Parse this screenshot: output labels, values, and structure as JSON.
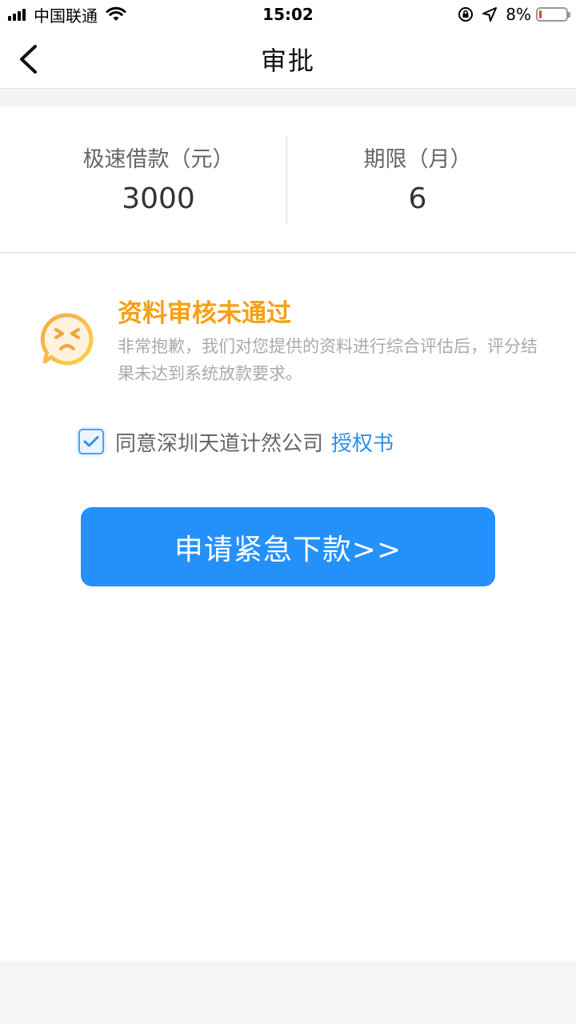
{
  "status_bar": {
    "carrier": "中国联通",
    "time": "15:02",
    "battery_percent": "8%",
    "battery_level": 0.08,
    "battery_color": "#e53935",
    "icons": [
      "signal-icon",
      "wifi-icon",
      "orientation-lock-icon",
      "location-icon",
      "battery-icon"
    ]
  },
  "nav": {
    "title": "审批",
    "back_icon": "chevron-left-icon"
  },
  "summary": {
    "loan_label": "极速借款（元）",
    "loan_value": "3000",
    "term_label": "期限（月）",
    "term_value": "6"
  },
  "result": {
    "icon": "sad-face-chat-icon",
    "title": "资料审核未通过",
    "description": "非常抱歉，我们对您提供的资料进行综合评估后，评分结果未达到系统放款要求。"
  },
  "agreement": {
    "checked": true,
    "text": "同意深圳天道计然公司",
    "link": "授权书"
  },
  "actions": {
    "apply_label": "申请紧急下款>>"
  },
  "colors": {
    "primary": "#2490fa",
    "warning": "#f5a015",
    "link": "#2f8fe6"
  }
}
